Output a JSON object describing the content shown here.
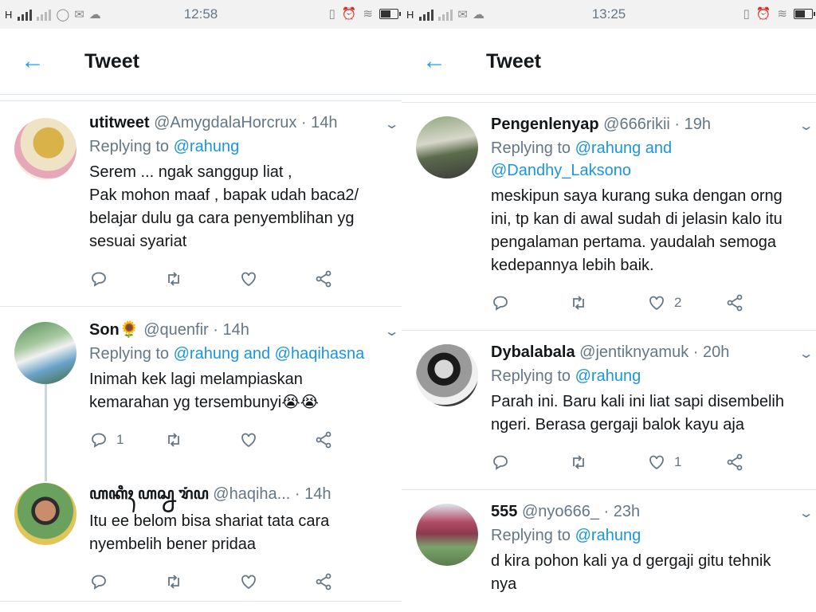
{
  "left": {
    "status": {
      "carrier": "H",
      "time": "12:58"
    },
    "header": {
      "title": "Tweet"
    },
    "tweets": [
      {
        "name": "utitweet",
        "handle": "@AmygdalaHorcrux",
        "time": "14h",
        "reply_prefix": "Replying to",
        "reply_mentions": "@rahung",
        "text_lines": [
          "Serem ... ngak sanggup liat ,",
          "Pak mohon maaf , bapak udah baca2/",
          "belajar dulu ga cara penyemblihan yg",
          "sesuai syariat"
        ],
        "reply_count": "",
        "like_count": ""
      },
      {
        "name": "Son🌻",
        "handle": "@quenfir",
        "time": "14h",
        "reply_prefix": "Replying to",
        "reply_mentions": "@rahung and @haqihasna",
        "text_lines": [
          "Inimah kek lagi melampiaskan",
          "kemarahan yg tersembunyi😭😭"
        ],
        "reply_count": "1",
        "like_count": ""
      },
      {
        "name": "ꦲꦏꦶꦃ ꦲꦱ꧀ꦤ ꦫꦁꦥ",
        "handle": "@haqiha...",
        "time": "14h",
        "reply_prefix": "",
        "reply_mentions": "",
        "text_lines": [
          "Itu ee belom bisa shariat tata cara",
          "nyembelih bener pridaa"
        ],
        "reply_count": "",
        "like_count": ""
      }
    ]
  },
  "right": {
    "status": {
      "carrier": "H",
      "time": "13:25"
    },
    "header": {
      "title": "Tweet"
    },
    "tweets": [
      {
        "name": "Pengenlenyap",
        "handle": "@666rikii",
        "time": "19h",
        "reply_prefix": "Replying to",
        "reply_mentions": "@rahung and",
        "reply_mentions_2": "@Dandhy_Laksono",
        "text_lines": [
          "meskipun saya kurang suka dengan orng",
          "ini, tp kan di awal sudah di jelasin kalo itu",
          "pengalaman pertama. yaudalah semoga",
          "kedepannya lebih baik."
        ],
        "reply_count": "",
        "like_count": "2"
      },
      {
        "name": "Dybalabala",
        "handle": "@jentiknyamuk",
        "time": "20h",
        "reply_prefix": "Replying to",
        "reply_mentions": "@rahung",
        "text_lines": [
          "Parah ini. Baru kali ini liat sapi disembelih",
          "ngeri. Berasa gergaji balok kayu aja"
        ],
        "reply_count": "",
        "like_count": "1"
      },
      {
        "name": "555",
        "handle": "@nyo666_",
        "time": "23h",
        "reply_prefix": "Replying to",
        "reply_mentions": "@rahung",
        "text_lines": [
          "d kira pohon kali ya d gergaji gitu tehnik",
          "nya"
        ],
        "reply_count": "",
        "like_count": ""
      }
    ]
  },
  "icons": {
    "back": "back-arrow-icon",
    "reply": "reply-icon",
    "retweet": "retweet-icon",
    "like": "heart-icon",
    "share": "share-icon",
    "menu": "chevron-down-icon"
  },
  "colors": {
    "accent": "#1da1f2",
    "mention": "#1b95e0",
    "muted": "#657786",
    "divider": "#e1e8ed"
  }
}
